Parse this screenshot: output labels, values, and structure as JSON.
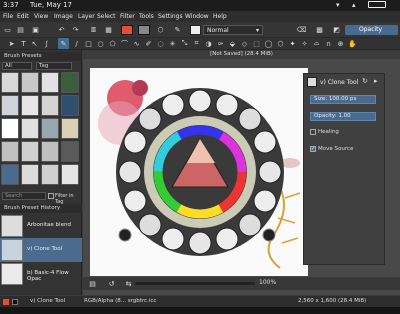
{
  "statusbar_top": {
    "time": "3:37",
    "date": "Tue, May 17"
  },
  "menu": [
    "File",
    "Edit",
    "View",
    "Image",
    "Layer",
    "Select",
    "Filter",
    "Tools",
    "Settings",
    "Window",
    "Help"
  ],
  "toolbar": {
    "blend_mode": "Normal",
    "opacity_label": "Opacity"
  },
  "left_panel": {
    "brush_presets_title": "Brush Presets",
    "filter_all": "All",
    "tag_label": "Tag",
    "search_placeholder": "Search",
    "filter_in_tag": "Filter in Tag",
    "history_title": "Brush Preset History",
    "history_items": [
      {
        "label": "Arbonitae blend"
      },
      {
        "label": "v) Clone Tool"
      },
      {
        "label": "b) Basic-4 Flow Opac"
      }
    ]
  },
  "document": {
    "title": "[Not Saved]  (28.4 MiB)"
  },
  "tool_options": {
    "tool_name": "v) Clone Tool",
    "size_label": "Size:",
    "size_value": "100.00 px",
    "opacity_label": "Opacity:",
    "opacity_value": "1.00",
    "healing_label": "Healing",
    "move_source_label": "Move Source"
  },
  "bottom": {
    "zoom": "100%"
  },
  "status": {
    "tool": "v) Clone Tool",
    "color_space": "RGB/Alpha (8... srgbtrc.icc",
    "dimensions": "2,560 x 1,600 (28.4 MiB)"
  },
  "colors": {
    "accent": "#4a6b8e",
    "fg_color": "#e94b33",
    "bg_color": "#111111"
  }
}
